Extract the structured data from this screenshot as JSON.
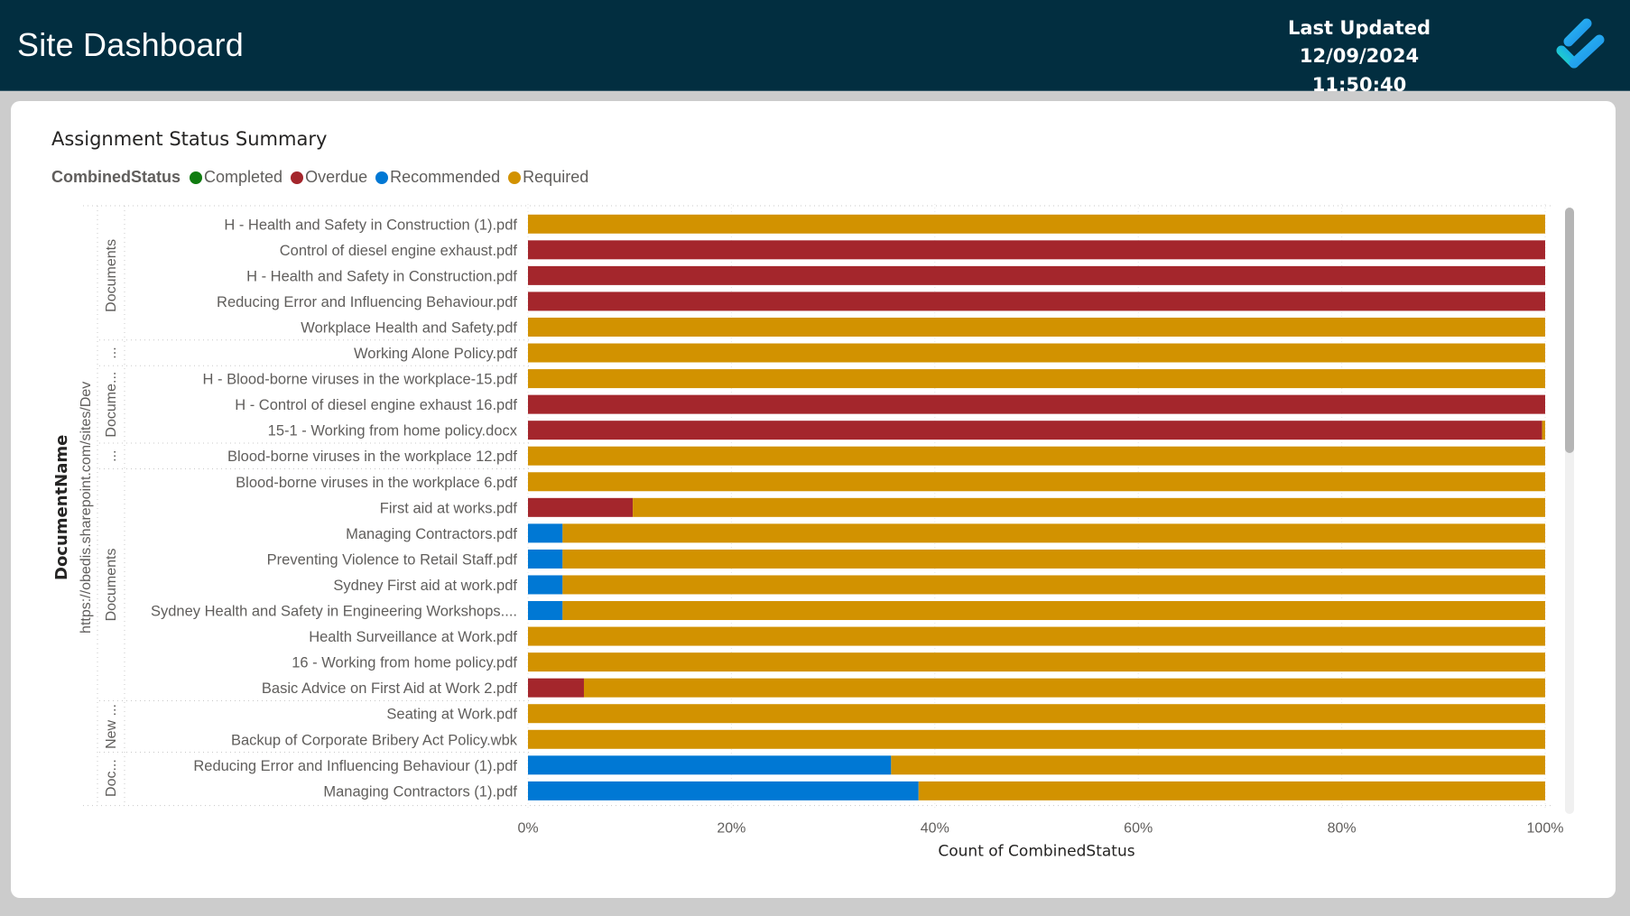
{
  "header": {
    "title": "Site Dashboard",
    "last_updated_label": "Last Updated",
    "last_updated_value": "12/09/2024 11:50:40",
    "logo_icon": "checkmark-logo-icon"
  },
  "card": {
    "title": "Assignment Status Summary"
  },
  "colors": {
    "Completed": "#107c10",
    "Overdue": "#a4262c",
    "Recommended": "#0078d4",
    "Required": "#d29200",
    "header_bg": "#022e40",
    "page_bg": "#cccccc"
  },
  "chart_data": {
    "type": "bar",
    "orientation": "horizontal",
    "stacking": "100% stacked",
    "title": "Assignment Status Summary",
    "xlabel": "Count of CombinedStatus",
    "ylabel": "DocumentName",
    "xlim": [
      0,
      100
    ],
    "x_ticks": [
      "0%",
      "20%",
      "40%",
      "60%",
      "80%",
      "100%"
    ],
    "grid": true,
    "legend": {
      "title": "CombinedStatus",
      "position": "top-left",
      "entries": [
        "Completed",
        "Overdue",
        "Recommended",
        "Required"
      ]
    },
    "hierarchy": {
      "site": "https://obedis.sharepoint.com/sites/Dev",
      "groups": [
        {
          "label": "Documents",
          "rows": 5
        },
        {
          "label": "...",
          "rows": 1
        },
        {
          "label": "Docume...",
          "rows": 3
        },
        {
          "label": "...",
          "rows": 1
        },
        {
          "label": "Documents",
          "rows": 9
        },
        {
          "label": "New ...",
          "rows": 2
        },
        {
          "label": "Doc...",
          "rows": 2
        }
      ]
    },
    "categories": [
      "H - Health and Safety in Construction (1).pdf",
      "Control of diesel engine exhaust.pdf",
      "H - Health and Safety in Construction.pdf",
      "Reducing Error and Influencing Behaviour.pdf",
      "Workplace Health and Safety.pdf",
      "Working Alone Policy.pdf",
      "H - Blood-borne viruses in the workplace-15.pdf",
      "H - Control of diesel engine exhaust 16.pdf",
      "15-1 - Working from home policy.docx",
      "Blood-borne viruses in the workplace 12.pdf",
      "Blood-borne viruses in the workplace 6.pdf",
      "First aid at works.pdf",
      "Managing Contractors.pdf",
      "Preventing Violence to Retail Staff.pdf",
      "Sydney First aid at work.pdf",
      "Sydney Health and Safety in Engineering Workshops....",
      "Health Surveillance at Work.pdf",
      "16 - Working from home policy.pdf",
      "Basic Advice on First Aid at Work 2.pdf",
      "Seating at Work.pdf",
      "Backup of Corporate Bribery Act Policy.wbk",
      "Reducing Error and Influencing Behaviour (1).pdf",
      "Managing Contractors (1).pdf"
    ],
    "series": [
      {
        "name": "Completed",
        "values": [
          0,
          0,
          0,
          0,
          0,
          0,
          0,
          0,
          0,
          0,
          0,
          0,
          0,
          0,
          0,
          0,
          0,
          0,
          0,
          0,
          0,
          0,
          0
        ]
      },
      {
        "name": "Overdue",
        "values": [
          0,
          100,
          100,
          100,
          0,
          0,
          0,
          100,
          99.7,
          0,
          0,
          10.3,
          0,
          0,
          0,
          0,
          0,
          0,
          5.5,
          0,
          0,
          0,
          0
        ]
      },
      {
        "name": "Recommended",
        "values": [
          0,
          0,
          0,
          0,
          0,
          0,
          0,
          0,
          0,
          0,
          0,
          0,
          3.4,
          3.4,
          3.4,
          3.4,
          0,
          0,
          0,
          0,
          0,
          35.7,
          38.4
        ]
      },
      {
        "name": "Required",
        "values": [
          100,
          0,
          0,
          0,
          100,
          100,
          100,
          0,
          0.3,
          100,
          100,
          89.7,
          96.6,
          96.6,
          96.6,
          96.6,
          100,
          100,
          94.5,
          100,
          100,
          64.3,
          61.6
        ]
      }
    ]
  }
}
